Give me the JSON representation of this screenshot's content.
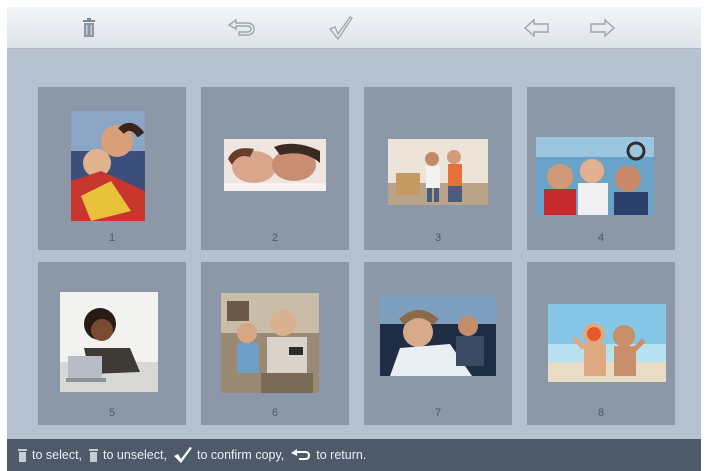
{
  "toolbar": {
    "icons": [
      "trash-icon",
      "return-icon",
      "checkmark-icon",
      "arrow-left-icon",
      "arrow-right-icon"
    ]
  },
  "thumbnails": [
    {
      "number": "1",
      "subject": "photo"
    },
    {
      "number": "2",
      "subject": "photo"
    },
    {
      "number": "3",
      "subject": "photo"
    },
    {
      "number": "4",
      "subject": "photo"
    },
    {
      "number": "5",
      "subject": "photo"
    },
    {
      "number": "6",
      "subject": "photo"
    },
    {
      "number": "7",
      "subject": "photo"
    },
    {
      "number": "8",
      "subject": "photo"
    }
  ],
  "hint": {
    "select": "to select,",
    "unselect": "to unselect,",
    "confirm": "to confirm copy,",
    "return": "to return."
  },
  "colors": {
    "screen_bg": "#b8c3d0",
    "tile_bg": "#8c98a8",
    "hint_bar_bg": "#4e5a69",
    "toolbar_bg": "#e8ecf0"
  }
}
